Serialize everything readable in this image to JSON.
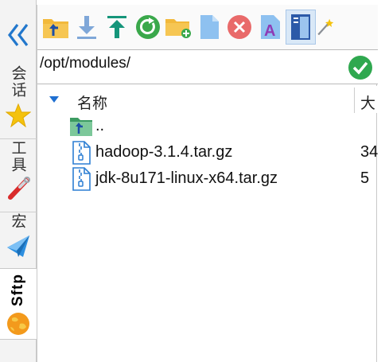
{
  "sidebar": {
    "collapse_icon": "double-chevron-left-icon",
    "tabs": [
      {
        "label": "会话",
        "icon": "star-icon",
        "active": false
      },
      {
        "label": "工具",
        "icon": "wrench-icon",
        "active": false
      },
      {
        "label": "宏",
        "icon": "paper-plane-icon",
        "active": false
      },
      {
        "label": "Sftp",
        "icon": "globe-icon",
        "active": true
      }
    ]
  },
  "toolbar": {
    "buttons": [
      {
        "icon": "parent-folder-icon"
      },
      {
        "icon": "download-icon"
      },
      {
        "icon": "upload-icon"
      },
      {
        "icon": "refresh-icon"
      },
      {
        "icon": "new-folder-icon"
      },
      {
        "icon": "new-file-icon"
      },
      {
        "icon": "delete-icon"
      },
      {
        "icon": "rename-icon"
      },
      {
        "icon": "panel-view-icon",
        "active": true
      },
      {
        "icon": "magic-wand-icon"
      }
    ]
  },
  "pathbar": {
    "path": "/opt/modules/",
    "confirm_icon": "check-circle-icon"
  },
  "table": {
    "header_name": "名称",
    "header_size": "大",
    "rows": [
      {
        "name": "..",
        "size": "",
        "icon": "parent-folder-icon"
      },
      {
        "name": "hadoop-3.1.4.tar.gz",
        "size": "34",
        "icon": "archive-file-icon"
      },
      {
        "name": "jdk-8u171-linux-x64.tar.gz",
        "size": "5",
        "icon": "archive-file-icon"
      }
    ]
  },
  "colors": {
    "folder": "#f2b93b",
    "parent_arrow": "#1d4fa6",
    "teal": "#15957a",
    "green": "#3aa84b",
    "delete_red": "#e96a6a",
    "rename_purple": "#8e3bb5",
    "ok_green": "#2fa84f"
  }
}
